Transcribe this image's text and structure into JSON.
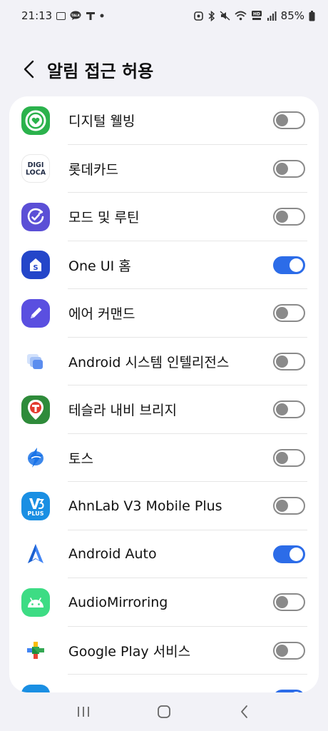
{
  "status_bar": {
    "time": "21:13",
    "talk_badge": "TALK",
    "hd_badge": "HD",
    "battery": "85%"
  },
  "header": {
    "title": "알림 접근 허용"
  },
  "apps": [
    {
      "label": "디지털 웰빙",
      "enabled": false,
      "icon": "digital-wellbeing-icon",
      "color": "#2bb24c"
    },
    {
      "label": "롯데카드",
      "enabled": false,
      "icon": "digiloca-icon",
      "color": "#1f2a44",
      "icon_text_top": "DIGI",
      "icon_text_bottom": "LOCA"
    },
    {
      "label": "모드 및 루틴",
      "enabled": false,
      "icon": "modes-routines-icon",
      "color": "#5b4fd6"
    },
    {
      "label": "One UI 홈",
      "enabled": true,
      "icon": "one-ui-home-icon",
      "color": "#2446c9"
    },
    {
      "label": "에어 커맨드",
      "enabled": false,
      "icon": "air-command-icon",
      "color": "#5a4fe0"
    },
    {
      "label": "Android 시스템 인텔리전스",
      "enabled": false,
      "icon": "system-intelligence-icon",
      "color": "#5b8def"
    },
    {
      "label": "테슬라 내비 브리지",
      "enabled": false,
      "icon": "tmap-icon",
      "color": "#2e8b3a"
    },
    {
      "label": "토스",
      "enabled": false,
      "icon": "toss-icon",
      "color": "#1a73e8"
    },
    {
      "label": "AhnLab V3 Mobile Plus",
      "enabled": false,
      "icon": "v3-icon",
      "color": "#1a8fe3",
      "icon_text": "PLUS"
    },
    {
      "label": "Android Auto",
      "enabled": true,
      "icon": "android-auto-icon",
      "color": "#4285f4"
    },
    {
      "label": "AudioMirroring",
      "enabled": false,
      "icon": "android-robot-icon",
      "color": "#3ddc84"
    },
    {
      "label": "Google Play 서비스",
      "enabled": false,
      "icon": "google-play-services-icon",
      "color": "#34a853"
    }
  ],
  "colors": {
    "accent": "#2c6ce8",
    "background": "#f2f2f7",
    "card": "#ffffff"
  }
}
